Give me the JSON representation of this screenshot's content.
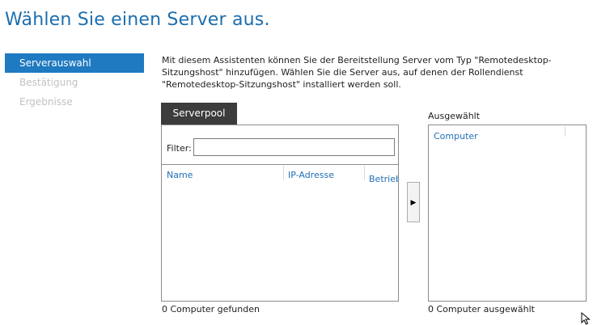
{
  "page": {
    "title": "Wählen Sie einen Server aus.",
    "description": "Mit diesem Assistenten können Sie der Bereitstellung Server vom Typ \"Remotedesktop-Sitzungshost\" hinzufügen. Wählen Sie die Server aus, auf denen der Rollendienst \"Remotedesktop-Sitzungshost\" installiert werden soll."
  },
  "nav": {
    "items": [
      {
        "label": "Serverauswahl",
        "active": true
      },
      {
        "label": "Bestätigung",
        "active": false
      },
      {
        "label": "Ergebnisse",
        "active": false
      }
    ]
  },
  "server_pool": {
    "tab_label": "Serverpool",
    "filter_label": "Filter:",
    "filter_value": "",
    "columns": [
      "Name",
      "IP-Adresse",
      "Betriebssystem"
    ],
    "rows": [],
    "status": "0 Computer gefunden"
  },
  "add_button": {
    "glyph": "▶"
  },
  "selected": {
    "label": "Ausgewählt",
    "column": "Computer",
    "rows": [],
    "status": "0 Computer ausgewählt"
  },
  "colors": {
    "accent": "#1f7ac1",
    "title": "#1b6eae",
    "tab": "#3c3c3c",
    "link": "#1f6fb5",
    "disabled": "#c2c2c2"
  }
}
